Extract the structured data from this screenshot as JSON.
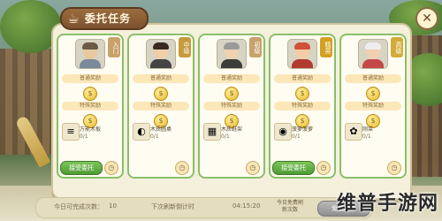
{
  "window": {
    "title": "委托任务",
    "title_icon": "tea-cup-icon",
    "close_label": "✕"
  },
  "cards": [
    {
      "badge": "入门",
      "badge_color": "#c7a26a",
      "normal_reward_label": "普通奖励",
      "special_reward_label": "特殊奖励",
      "item_name": "万能木板",
      "item_icon": "≡",
      "item_count": "0/1",
      "accept_label": "接受委托",
      "show_accept": true,
      "avatar": {
        "skin": "#e8c8a0",
        "hair": "#6b5a48",
        "body": "#7a8a9a"
      }
    },
    {
      "badge": "中级",
      "badge_color": "#c79a3c",
      "normal_reward_label": "普通奖励",
      "special_reward_label": "特殊奖励",
      "item_name": "木质圆桌",
      "item_icon": "◐",
      "item_count": "0/1",
      "accept_label": "",
      "show_accept": false,
      "avatar": {
        "skin": "#f0cfa8",
        "hair": "#3a2a22",
        "body": "#444444"
      }
    },
    {
      "badge": "初级",
      "badge_color": "#c7a26a",
      "normal_reward_label": "普通奖励",
      "special_reward_label": "特殊奖励",
      "item_name": "木质鞋架",
      "item_icon": "▦",
      "item_count": "0/1",
      "accept_label": "",
      "show_accept": false,
      "avatar": {
        "skin": "#f0d2b0",
        "hair": "#9a9a9a",
        "body": "#3c3c3c"
      }
    },
    {
      "badge": "精英",
      "badge_color": "#d4a020",
      "normal_reward_label": "普通奖励",
      "special_reward_label": "特殊奖励",
      "item_name": "菠萝菠萝",
      "item_icon": "◉",
      "item_count": "0/1",
      "accept_label": "接受委托",
      "show_accept": true,
      "avatar": {
        "skin": "#f2cda6",
        "hair": "#d0503a",
        "body": "#b23a30"
      }
    },
    {
      "badge": "高级",
      "badge_color": "#d4aa3a",
      "normal_reward_label": "普通奖励",
      "special_reward_label": "特殊奖励",
      "item_name": "刚菜",
      "item_icon": "✿",
      "item_count": "0/1",
      "accept_label": "",
      "show_accept": false,
      "avatar": {
        "skin": "#f0d0b0",
        "hair": "#eeeeee",
        "body": "#c44848"
      }
    }
  ],
  "bottom": {
    "completed_label": "今日可完成次数：",
    "completed_value": "10",
    "refresh_time_label": "下次刷新倒计时",
    "refresh_time_value": "04:15:20",
    "free_refresh_label": "今日免费刷新次数",
    "refresh_button_label": "免费刷新"
  },
  "watermark": "维普手游网"
}
